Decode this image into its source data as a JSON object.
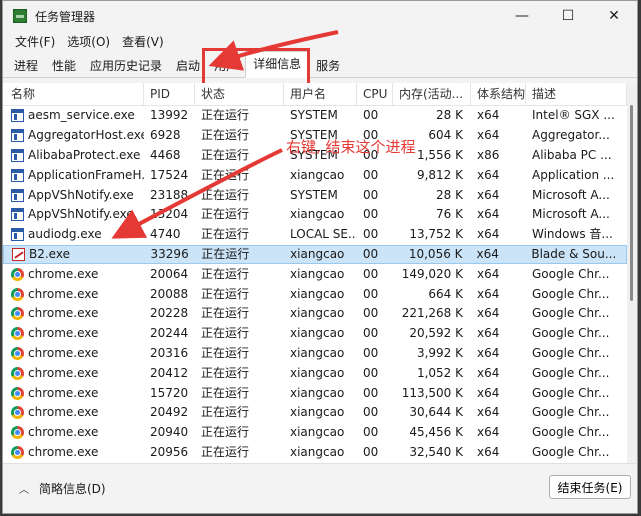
{
  "window": {
    "title": "任务管理器",
    "minimize": "—",
    "maximize": "☐",
    "close": "✕"
  },
  "menu": [
    "文件(F)",
    "选项(O)",
    "查看(V)"
  ],
  "tabs": [
    "进程",
    "性能",
    "应用历史记录",
    "启动",
    "用户",
    "详细信息",
    "服务"
  ],
  "active_tab_index": 5,
  "columns": [
    "名称",
    "PID",
    "状态",
    "用户名",
    "CPU",
    "内存(活动...",
    "体系结构",
    "描述"
  ],
  "rows": [
    {
      "icon": "window-icon",
      "name": "aesm_service.exe",
      "pid": "13992",
      "status": "正在运行",
      "user": "SYSTEM",
      "cpu": "00",
      "mem": "28 K",
      "arch": "x64",
      "desc": "Intel® SGX ..."
    },
    {
      "icon": "window-icon",
      "name": "AggregatorHost.exe",
      "pid": "6928",
      "status": "正在运行",
      "user": "SYSTEM",
      "cpu": "00",
      "mem": "604 K",
      "arch": "x64",
      "desc": "Aggregator..."
    },
    {
      "icon": "window-icon",
      "name": "AlibabaProtect.exe",
      "pid": "4468",
      "status": "正在运行",
      "user": "SYSTEM",
      "cpu": "00",
      "mem": "1,556 K",
      "arch": "x86",
      "desc": "Alibaba PC ..."
    },
    {
      "icon": "window-icon",
      "name": "ApplicationFrameH...",
      "pid": "17524",
      "status": "正在运行",
      "user": "xiangcao",
      "cpu": "00",
      "mem": "9,812 K",
      "arch": "x64",
      "desc": "Application ..."
    },
    {
      "icon": "window-icon",
      "name": "AppVShNotify.exe",
      "pid": "23188",
      "status": "正在运行",
      "user": "SYSTEM",
      "cpu": "00",
      "mem": "28 K",
      "arch": "x64",
      "desc": "Microsoft A..."
    },
    {
      "icon": "window-icon",
      "name": "AppVShNotify.exe",
      "pid": "13204",
      "status": "正在运行",
      "user": "xiangcao",
      "cpu": "00",
      "mem": "76 K",
      "arch": "x64",
      "desc": "Microsoft A..."
    },
    {
      "icon": "window-icon",
      "name": "audiodg.exe",
      "pid": "4740",
      "status": "正在运行",
      "user": "LOCAL SE...",
      "cpu": "00",
      "mem": "13,752 K",
      "arch": "x64",
      "desc": "Windows 音..."
    },
    {
      "icon": "blade-icon",
      "name": "B2.exe",
      "pid": "33296",
      "status": "正在运行",
      "user": "xiangcao",
      "cpu": "00",
      "mem": "10,056 K",
      "arch": "x64",
      "desc": "Blade & Sou...",
      "selected": true
    },
    {
      "icon": "chrome-icon",
      "name": "chrome.exe",
      "pid": "20064",
      "status": "正在运行",
      "user": "xiangcao",
      "cpu": "00",
      "mem": "149,020 K",
      "arch": "x64",
      "desc": "Google Chr..."
    },
    {
      "icon": "chrome-icon",
      "name": "chrome.exe",
      "pid": "20088",
      "status": "正在运行",
      "user": "xiangcao",
      "cpu": "00",
      "mem": "664 K",
      "arch": "x64",
      "desc": "Google Chr..."
    },
    {
      "icon": "chrome-icon",
      "name": "chrome.exe",
      "pid": "20228",
      "status": "正在运行",
      "user": "xiangcao",
      "cpu": "00",
      "mem": "221,268 K",
      "arch": "x64",
      "desc": "Google Chr..."
    },
    {
      "icon": "chrome-icon",
      "name": "chrome.exe",
      "pid": "20244",
      "status": "正在运行",
      "user": "xiangcao",
      "cpu": "00",
      "mem": "20,592 K",
      "arch": "x64",
      "desc": "Google Chr..."
    },
    {
      "icon": "chrome-icon",
      "name": "chrome.exe",
      "pid": "20316",
      "status": "正在运行",
      "user": "xiangcao",
      "cpu": "00",
      "mem": "3,992 K",
      "arch": "x64",
      "desc": "Google Chr..."
    },
    {
      "icon": "chrome-icon",
      "name": "chrome.exe",
      "pid": "20412",
      "status": "正在运行",
      "user": "xiangcao",
      "cpu": "00",
      "mem": "1,052 K",
      "arch": "x64",
      "desc": "Google Chr..."
    },
    {
      "icon": "chrome-icon",
      "name": "chrome.exe",
      "pid": "15720",
      "status": "正在运行",
      "user": "xiangcao",
      "cpu": "00",
      "mem": "113,500 K",
      "arch": "x64",
      "desc": "Google Chr..."
    },
    {
      "icon": "chrome-icon",
      "name": "chrome.exe",
      "pid": "20492",
      "status": "正在运行",
      "user": "xiangcao",
      "cpu": "00",
      "mem": "30,644 K",
      "arch": "x64",
      "desc": "Google Chr..."
    },
    {
      "icon": "chrome-icon",
      "name": "chrome.exe",
      "pid": "20940",
      "status": "正在运行",
      "user": "xiangcao",
      "cpu": "00",
      "mem": "45,456 K",
      "arch": "x64",
      "desc": "Google Chr..."
    },
    {
      "icon": "chrome-icon",
      "name": "chrome.exe",
      "pid": "20956",
      "status": "正在运行",
      "user": "xiangcao",
      "cpu": "00",
      "mem": "32,540 K",
      "arch": "x64",
      "desc": "Google Chr..."
    }
  ],
  "annotation": {
    "text": "右键, 结束这个进程",
    "color": "#e53935"
  },
  "footer": {
    "fewer_details": "简略信息(D)",
    "end_task": "结束任务(E)"
  }
}
